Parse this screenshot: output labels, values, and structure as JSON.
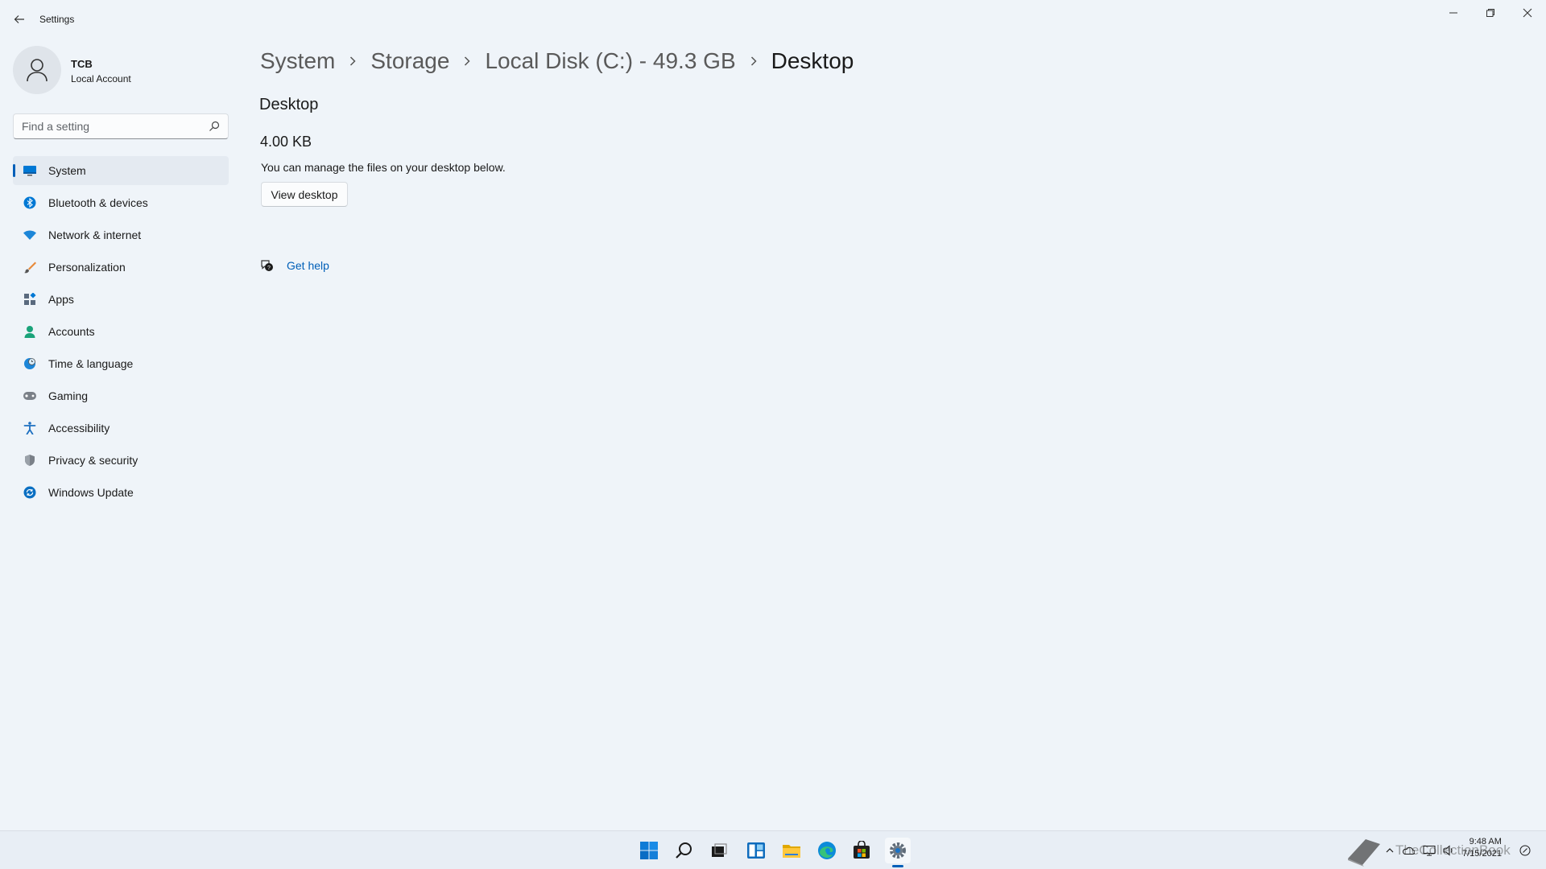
{
  "window": {
    "title": "Settings",
    "controls": {
      "minimize": "minimize-icon",
      "restore": "restore-icon",
      "close": "close-icon"
    }
  },
  "profile": {
    "name": "TCB",
    "account_type": "Local Account"
  },
  "search": {
    "placeholder": "Find a setting",
    "value": ""
  },
  "nav": {
    "items": [
      {
        "label": "System",
        "icon": "system-icon",
        "active": true
      },
      {
        "label": "Bluetooth & devices",
        "icon": "bluetooth-icon"
      },
      {
        "label": "Network & internet",
        "icon": "wifi-icon"
      },
      {
        "label": "Personalization",
        "icon": "brush-icon"
      },
      {
        "label": "Apps",
        "icon": "apps-icon"
      },
      {
        "label": "Accounts",
        "icon": "person-icon"
      },
      {
        "label": "Time & language",
        "icon": "clock-globe-icon"
      },
      {
        "label": "Gaming",
        "icon": "gamepad-icon"
      },
      {
        "label": "Accessibility",
        "icon": "accessibility-icon"
      },
      {
        "label": "Privacy & security",
        "icon": "shield-icon"
      },
      {
        "label": "Windows Update",
        "icon": "update-icon"
      }
    ]
  },
  "breadcrumb": {
    "items": [
      "System",
      "Storage",
      "Local Disk (C:) - 49.3 GB",
      "Desktop"
    ]
  },
  "main": {
    "section_title": "Desktop",
    "size": "4.00 KB",
    "description": "You can manage the files on your desktop below.",
    "view_button": "View desktop",
    "help_link": "Get help"
  },
  "taskbar": {
    "apps": [
      "start-icon",
      "search-icon",
      "task-view-icon",
      "widgets-icon",
      "file-explorer-icon",
      "edge-icon",
      "store-icon",
      "settings-icon"
    ],
    "active_app": "settings-icon",
    "tray": [
      "chevron-up-icon",
      "onedrive-icon",
      "network-icon",
      "volume-icon"
    ],
    "time": "9:48 AM",
    "date": "7/15/2021",
    "watermark_text": "TheCollectionBook"
  },
  "colors": {
    "accent": "#005fb8",
    "background": "#eff4f9",
    "nav_active_bg": "#e4eaf1",
    "taskbar_bg": "#e8eef5"
  }
}
